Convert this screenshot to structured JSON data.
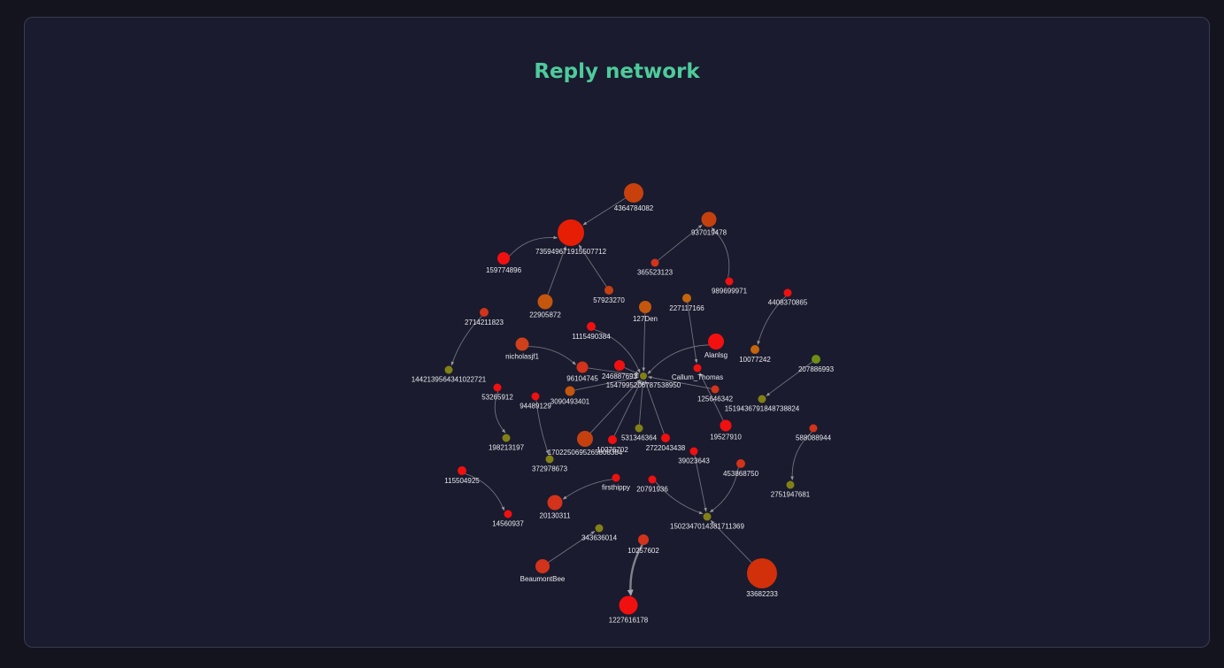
{
  "title": "Reply network",
  "colors": {
    "background": "#14141f",
    "panel": "#1a1b2e",
    "title": "#4ecb9b",
    "edge": "#8e8e98",
    "label": "#e8e8ee"
  },
  "chart_data": {
    "type": "network",
    "nodes": [
      {
        "id": "4364784082",
        "color": "#c8410d",
        "size": 11
      },
      {
        "id": "735949671915507712",
        "color": "#e51e05",
        "size": 15
      },
      {
        "id": "159774896",
        "color": "#f01010",
        "size": 7
      },
      {
        "id": "22905872",
        "color": "#c4560d",
        "size": 8.5
      },
      {
        "id": "57923270",
        "color": "#c44010",
        "size": 5
      },
      {
        "id": "937019478",
        "color": "#c4410f",
        "size": 8.5
      },
      {
        "id": "365523123",
        "color": "#d2331a",
        "size": 4.5
      },
      {
        "id": "989699971",
        "color": "#f01010",
        "size": 4.5
      },
      {
        "id": "127Den",
        "color": "#c4560d",
        "size": 7
      },
      {
        "id": "227117166",
        "color": "#c4650d",
        "size": 5
      },
      {
        "id": "4408370865",
        "color": "#f01010",
        "size": 4.5
      },
      {
        "id": "2714211823",
        "color": "#d2331a",
        "size": 5
      },
      {
        "id": "1115490384",
        "color": "#f01010",
        "size": 5
      },
      {
        "id": "Alanlsg",
        "color": "#f51010",
        "size": 9
      },
      {
        "id": "10077242",
        "color": "#c4650d",
        "size": 5
      },
      {
        "id": "nicholasjf1",
        "color": "#d0401b",
        "size": 7.5
      },
      {
        "id": "1442139564341022721",
        "color": "#818016",
        "size": 4.5
      },
      {
        "id": "96104745",
        "color": "#d2331a",
        "size": 6.5
      },
      {
        "id": "246887693",
        "color": "#f01010",
        "size": 6
      },
      {
        "id": "1547995206787538950",
        "color": "#818016",
        "size": 4
      },
      {
        "id": "Callum_Thomas",
        "color": "#f01010",
        "size": 4.5
      },
      {
        "id": "207886993",
        "color": "#6e8e14",
        "size": 5
      },
      {
        "id": "53265912",
        "color": "#f01010",
        "size": 4.5
      },
      {
        "id": "94489129",
        "color": "#f01010",
        "size": 4.5
      },
      {
        "id": "3090493401",
        "color": "#c4560d",
        "size": 5.5
      },
      {
        "id": "125646342",
        "color": "#d2331a",
        "size": 4.5
      },
      {
        "id": "1519436791848738824",
        "color": "#818016",
        "size": 4.5
      },
      {
        "id": "198213197",
        "color": "#818016",
        "size": 4.5
      },
      {
        "id": "1702250695265808384",
        "color": "#c4410f",
        "size": 9
      },
      {
        "id": "10276702",
        "color": "#f01010",
        "size": 5
      },
      {
        "id": "531346364",
        "color": "#818016",
        "size": 4.5
      },
      {
        "id": "2722043438",
        "color": "#f01010",
        "size": 5
      },
      {
        "id": "19527910",
        "color": "#f01010",
        "size": 6.5
      },
      {
        "id": "588088944",
        "color": "#d2331a",
        "size": 4.5
      },
      {
        "id": "372978673",
        "color": "#818016",
        "size": 4.5
      },
      {
        "id": "39023643",
        "color": "#f01010",
        "size": 4.5
      },
      {
        "id": "453868750",
        "color": "#d2331a",
        "size": 5
      },
      {
        "id": "115504925",
        "color": "#f01010",
        "size": 5
      },
      {
        "id": "firsthippy",
        "color": "#f01010",
        "size": 4.5
      },
      {
        "id": "20791936",
        "color": "#f01010",
        "size": 4.5
      },
      {
        "id": "2751947681",
        "color": "#818016",
        "size": 4.5
      },
      {
        "id": "20130311",
        "color": "#d2331a",
        "size": 8.5
      },
      {
        "id": "14560937",
        "color": "#f01010",
        "size": 4.5
      },
      {
        "id": "1502347014381711369",
        "color": "#818016",
        "size": 4.5
      },
      {
        "id": "343636014",
        "color": "#818016",
        "size": 4.5
      },
      {
        "id": "10257602",
        "color": "#d2331a",
        "size": 6
      },
      {
        "id": "BeaumontBee",
        "color": "#d2331a",
        "size": 8
      },
      {
        "id": "33682233",
        "color": "#d2300a",
        "size": 17
      },
      {
        "id": "1227616178",
        "color": "#f01010",
        "size": 10.5
      }
    ],
    "edges": [
      {
        "source": "4364784082",
        "target": "735949671915507712"
      },
      {
        "source": "159774896",
        "target": "735949671915507712"
      },
      {
        "source": "22905872",
        "target": "735949671915507712"
      },
      {
        "source": "57923270",
        "target": "735949671915507712"
      },
      {
        "source": "365523123",
        "target": "937019478"
      },
      {
        "source": "989699971",
        "target": "937019478"
      },
      {
        "source": "4408370865",
        "target": "10077242"
      },
      {
        "source": "2714211823",
        "target": "1442139564341022721"
      },
      {
        "source": "1115490384",
        "target": "1547995206787538950"
      },
      {
        "source": "127Den",
        "target": "1547995206787538950"
      },
      {
        "source": "Alanlsg",
        "target": "1547995206787538950"
      },
      {
        "source": "227117166",
        "target": "Callum_Thomas"
      },
      {
        "source": "nicholasjf1",
        "target": "96104745"
      },
      {
        "source": "96104745",
        "target": "1547995206787538950"
      },
      {
        "source": "246887693",
        "target": "1547995206787538950"
      },
      {
        "source": "3090493401",
        "target": "1547995206787538950"
      },
      {
        "source": "125646342",
        "target": "1547995206787538950"
      },
      {
        "source": "1702250695265808384",
        "target": "1547995206787538950"
      },
      {
        "source": "10276702",
        "target": "1547995206787538950"
      },
      {
        "source": "531346364",
        "target": "1547995206787538950"
      },
      {
        "source": "2722043438",
        "target": "1547995206787538950"
      },
      {
        "source": "19527910",
        "target": "Callum_Thomas"
      },
      {
        "source": "207886993",
        "target": "1519436791848738824"
      },
      {
        "source": "53265912",
        "target": "198213197"
      },
      {
        "source": "94489129",
        "target": "372978673"
      },
      {
        "source": "588088944",
        "target": "2751947681"
      },
      {
        "source": "115504925",
        "target": "14560937"
      },
      {
        "source": "firsthippy",
        "target": "20130311"
      },
      {
        "source": "20791936",
        "target": "1502347014381711369"
      },
      {
        "source": "39023643",
        "target": "1502347014381711369"
      },
      {
        "source": "453868750",
        "target": "1502347014381711369"
      },
      {
        "source": "33682233",
        "target": "1502347014381711369"
      },
      {
        "source": "BeaumontBee",
        "target": "343636014"
      },
      {
        "source": "10257602",
        "target": "1227616178",
        "weight": 3
      }
    ]
  }
}
